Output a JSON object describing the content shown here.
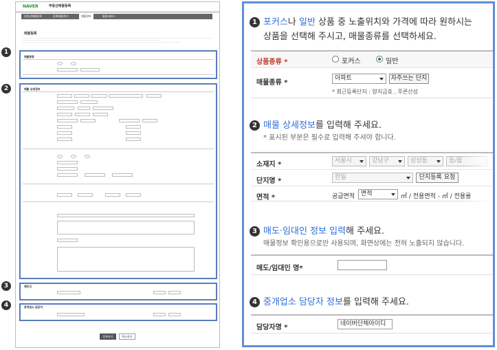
{
  "thumb": {
    "logo": "NAVER",
    "title": "부동산매물등록",
    "nav_tabs": [
      "부동산매물등록",
      "등록매물관리",
      "매물정보",
      "통합서비스"
    ],
    "page_heading": "매물등록",
    "sections": [
      "매물종류",
      "매물 상세정보",
      "매도인",
      "중개업소 담당자"
    ],
    "buttons": [
      "등록하기",
      "취소하기"
    ]
  },
  "steps": [
    {
      "num": "1",
      "prefix_blue": "포커스",
      "mid1": "나 ",
      "blue2": "일반",
      "rest": " 상품 중 노출위치와 가격에 따라 원하시는",
      "line2": "상품을 선택해 주시고, 매물종류를 선택하세요."
    },
    {
      "num": "2",
      "blue": "매물 상세정보",
      "rest": "를 입력해 주세요.",
      "sub": "* 표시된 부분은 필수로 입력해 주셔야 합니다."
    },
    {
      "num": "3",
      "blue": "매도·임대인 정보 입력",
      "rest": "해 주세요.",
      "sub": "매물정보 확인용으로만 사용되며, 화면상에는 전혀 노출되지 않습니다."
    },
    {
      "num": "4",
      "blue": "중개업소 담당자 정보",
      "rest": "를 입력해 주세요."
    }
  ],
  "form1": {
    "product_label": "상품종류 *",
    "opt_focus": "포커스",
    "opt_normal": "일반",
    "type_label": "매물종류 *",
    "type_value": "아파트",
    "freq_button": "자주쓰는 단지",
    "recent": "* 최근등록단지 : 양지금호 , 푸른산성"
  },
  "form2": {
    "addr_label": "소재지 *",
    "addr_city": "서울시",
    "addr_gu": "강남구",
    "addr_dong": "삼성동",
    "addr_more": "동/읍",
    "complex_label": "단지명 *",
    "complex_value": "한일",
    "complex_button": "단지등록 요청",
    "area_label": "면적 *",
    "area_supply": "공급면적",
    "area_select": "면적",
    "area_unit": "㎡ / 전용면적 - ㎡ / 전용률"
  },
  "form3": {
    "seller_label": "매도/임대인 명*"
  },
  "form4": {
    "agent_label": "담당자명 *",
    "agent_value": "네이버단체아이디"
  }
}
